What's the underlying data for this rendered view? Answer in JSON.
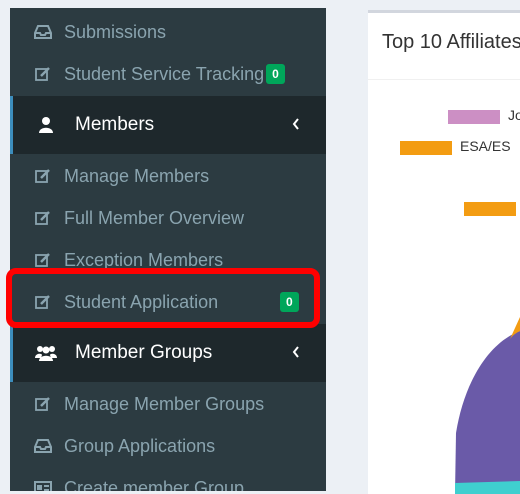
{
  "sidebar": {
    "items": [
      {
        "key": "submissions",
        "label": "Submissions",
        "icon": "inbox-icon"
      },
      {
        "key": "student_service_tracking",
        "label": "Student Service Tracking",
        "icon": "edit-icon",
        "badge": "0"
      }
    ],
    "members": {
      "label": "Members",
      "icon": "user-icon",
      "children": [
        {
          "label": "Manage Members",
          "icon": "edit-icon"
        },
        {
          "label": "Full Member Overview",
          "icon": "edit-icon"
        },
        {
          "label": "Exception Members",
          "icon": "edit-icon"
        },
        {
          "label": "Student Application",
          "icon": "edit-icon",
          "badge": "0"
        }
      ]
    },
    "member_groups": {
      "label": "Member Groups",
      "icon": "users-icon",
      "children": [
        {
          "label": "Manage Member Groups",
          "icon": "edit-icon"
        },
        {
          "label": "Group Applications",
          "icon": "inbox-icon"
        },
        {
          "label": "Create member Group",
          "icon": "id-card-icon"
        }
      ]
    }
  },
  "panel": {
    "title": "Top 10 Affiliates",
    "legend": [
      "Jo",
      "ESA/ES"
    ]
  },
  "colors": {
    "sidebar_bg": "#2c3b41",
    "header_bg": "#1e282c",
    "badge": "#00a65a",
    "highlight": "#ff0000",
    "pie_purple": "#6a5aa8",
    "pie_orange": "#f39c12",
    "pie_pink": "#cc8fc4",
    "pie_teal": "#3fcfcf"
  }
}
